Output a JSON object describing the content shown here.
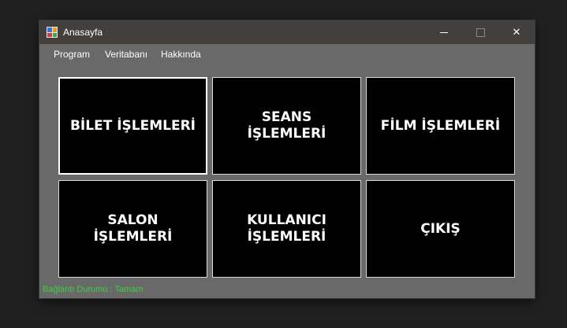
{
  "window": {
    "title": "Anasayfa",
    "controls": {
      "minimize_icon": "minimize-icon",
      "maximize_icon": "maximize-icon",
      "close_glyph": "✕"
    }
  },
  "menu": {
    "items": [
      {
        "label": "Program"
      },
      {
        "label": "Veritabanı"
      },
      {
        "label": "Hakkında"
      }
    ]
  },
  "tiles": [
    {
      "label": "BİLET İŞLEMLERİ"
    },
    {
      "label": "SEANS\nİŞLEMLERİ"
    },
    {
      "label": "FİLM İŞLEMLERİ"
    },
    {
      "label": "SALON\nİŞLEMLERİ"
    },
    {
      "label": "KULLANICI\nİŞLEMLERİ"
    },
    {
      "label": "ÇIKIŞ"
    }
  ],
  "status": {
    "text": "Bağlantı Durumu : Tamam",
    "color": "#3cd13c"
  },
  "colors": {
    "background": "#202020",
    "titlebar": "#433f3c",
    "client_area": "#696969",
    "tile_fill": "#000000",
    "tile_border": "#d9d9d9"
  }
}
